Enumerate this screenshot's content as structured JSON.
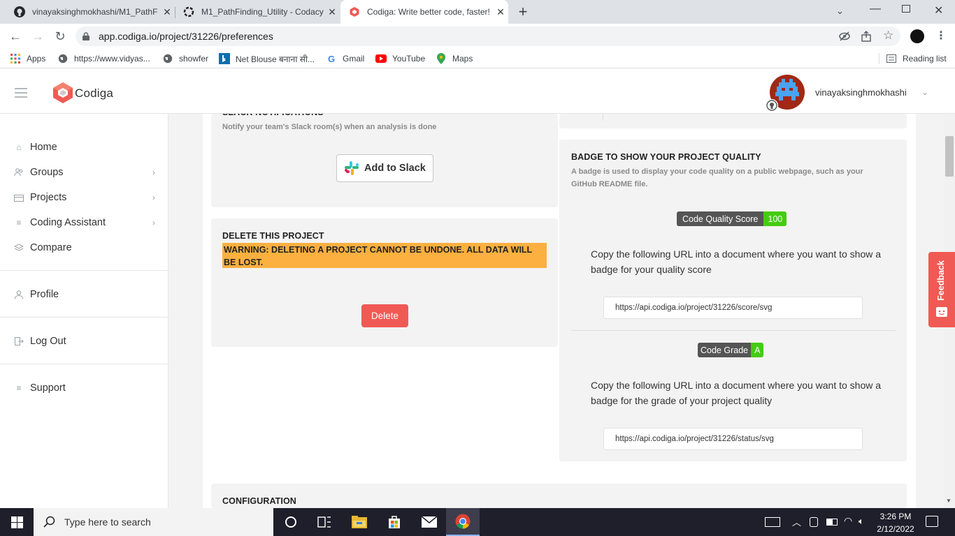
{
  "browser": {
    "tabs": [
      {
        "title": "vinayaksinghmokhashi/M1_PathF",
        "close": "✕"
      },
      {
        "title": "M1_PathFinding_Utility - Codacy",
        "close": "✕"
      },
      {
        "title": "Codiga: Write better code, faster!",
        "close": "✕"
      }
    ],
    "new_tab": "+",
    "url": "app.codiga.io/project/31226/preferences",
    "bookmarks": [
      "Apps",
      "https://www.vidyas...",
      "showfer",
      "Net Blouse बनाना सी...",
      "Gmail",
      "YouTube",
      "Maps"
    ],
    "reading_list": "Reading list"
  },
  "app": {
    "logo": "Codiga",
    "username": "vinayaksinghmokhashi"
  },
  "sidebar": {
    "items": [
      {
        "label": "Home"
      },
      {
        "label": "Groups"
      },
      {
        "label": "Projects"
      },
      {
        "label": "Coding Assistant"
      },
      {
        "label": "Compare"
      },
      {
        "label": "Profile"
      },
      {
        "label": "Log Out"
      },
      {
        "label": "Support"
      }
    ]
  },
  "slack": {
    "title": "SLACK NOTIFICATIONS",
    "subtitle": "Notify your team's Slack room(s) when an analysis is done",
    "button": "Add to Slack"
  },
  "delete_project": {
    "title": "DELETE THIS PROJECT",
    "warning": "WARNING: DELETING A PROJECT CANNOT BE UNDONE. ALL DATA WILL BE LOST.",
    "button": "Delete"
  },
  "badge": {
    "title": "BADGE TO SHOW YOUR PROJECT QUALITY",
    "subtitle": "A badge is used to display your code quality on a public webpage, such as your GitHub README file.",
    "score_label": "Code Quality Score",
    "score_value": "100",
    "score_text": "Copy the following URL into a document where you want to show a badge for your quality score",
    "score_url": "https://api.codiga.io/project/31226/score/svg",
    "grade_label": "Code Grade",
    "grade_value": "A",
    "grade_text": "Copy the following URL into a document where you want to show a badge for the grade of your project quality",
    "grade_url": "https://api.codiga.io/project/31226/status/svg"
  },
  "configuration": {
    "title": "CONFIGURATION"
  },
  "feedback": "Feedback",
  "taskbar": {
    "search_placeholder": "Type here to search",
    "time": "3:26 PM",
    "date": "2/12/2022"
  },
  "colors": {
    "accent": "#f05a55",
    "warning": "#fbb040",
    "badge_dark": "#555555",
    "badge_green": "#4c1"
  }
}
